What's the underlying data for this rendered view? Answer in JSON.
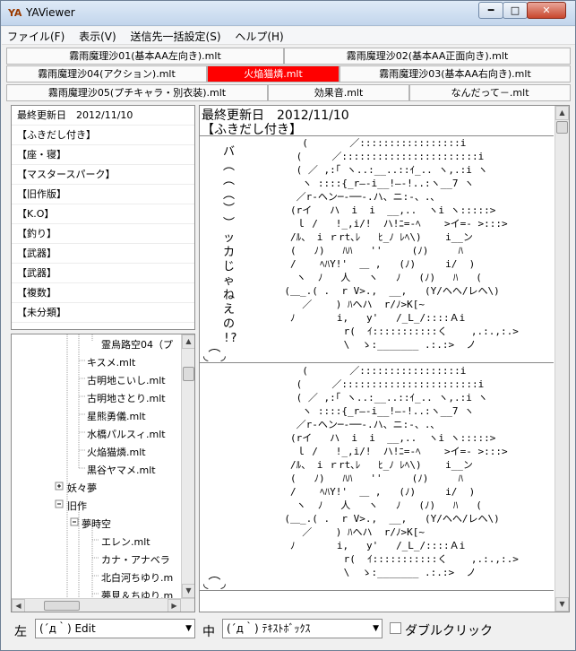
{
  "window": {
    "title": "YAViewer",
    "app_icon": "YA"
  },
  "menu": [
    "ファイル(F)",
    "表示(V)",
    "送信先一括設定(S)",
    "ヘルプ(H)"
  ],
  "tabs_row1": [
    "霧雨魔理沙01(基本AA左向き).mlt",
    "霧雨魔理沙02(基本AA正面向き).mlt"
  ],
  "tabs_row2": [
    "霧雨魔理沙04(アクション).mlt",
    "火焔猫燐.mlt",
    "霧雨魔理沙03(基本AA右向き).mlt"
  ],
  "tabs_row3": [
    "霧雨魔理沙05(プチキャラ・別衣装).mlt",
    "効果音.mlt",
    "なんだって－.mlt"
  ],
  "active_tab": "火焔猫燐.mlt",
  "categories": [
    "最終更新日　2012/11/10",
    "【ふきだし付き】",
    "【座・寝】",
    "【マスタースパーク】",
    "【旧作版】",
    "【K.O】",
    "【釣り】",
    "【武器】",
    "【武器】",
    "【複数】",
    "【未分類】"
  ],
  "tree": [
    "霊烏路空04（プ",
    "キスメ.mlt",
    "古明地こいし.mlt",
    "古明地さとり.mlt",
    "星熊勇儀.mlt",
    "水橋パルスィ.mlt",
    "火焔猫燐.mlt",
    "黒谷ヤマメ.mlt",
    "妖々夢",
    "旧作",
    "夢時空",
    "エレン.mlt",
    "カナ・アナベラ",
    "北白河ちゆり.m",
    "夢見＆ちゆり.m"
  ],
  "preview": {
    "header": "最終更新日　2012/11/10",
    "section": "【ふきだし付き】",
    "speech": "バ\n︵\n︵\n︵\n︶\n︶\nッ\nカ\nじ\nゃ\nね\nえ\nの\n!?",
    "aa_lines": [
      "          (       ／:::::::::::::::::i",
      "         (     ／:::::::::::::::::::::::i",
      "         ( ／ ,:｢ ヽ..:__..::ｲ_.. ヽ,.:i ヽ",
      "          ヽ ::::{_r―‐i__!―‐!..:ヽ__7 ヽ",
      "         ／r‐ヘン─‐──‐.ハ、ニ:‐、.､",
      "        (rイ   ハ  i  i  __,..  ヽi ヽ:::::>",
      "         ｌ /   !_,i/!  ハ!ﾆ=-ﾍ    >イ=- >:::>",
      "        /ﾙ、 i ｒrt､ﾚ   ﾋ_ﾉ ﾚﾍ\\)    i__ン",
      "        (   ﾉ)   ﾊﾊ   ''     (ﾉ)     ﾊ",
      "        /    ﾍﾊY!'  ＿ ,   (ﾉ)     i/  )",
      "         ヽ  ﾉ   人   ヽ   ﾉ   (ﾉ)   ﾊ   (",
      "       (＿_.( .  r V>.,  __,   (Y/ヘヘ/レヘ\\)",
      "          ／    ) ﾊヘハ  r/ﾉ>K[~  ",
      "        ﾉ       i,   y'   /_L_/::::Ａi",
      "                 r(  ｲ:::::::::::く    ,.:.,:.>",
      "                 \\  ゝ:_______ .:.:>  ノ"
    ]
  },
  "bottom": {
    "left_label": "左",
    "left_value": "(´д｀) Edit",
    "mid_label": "中",
    "mid_value": "(´д｀) ﾃｷｽﾄﾎﾞｯｸｽ",
    "checkbox_label": "ダブルクリック"
  },
  "colors": {
    "active_tab": "#ff0000",
    "title_gradient_top": "#dfeaf7"
  }
}
